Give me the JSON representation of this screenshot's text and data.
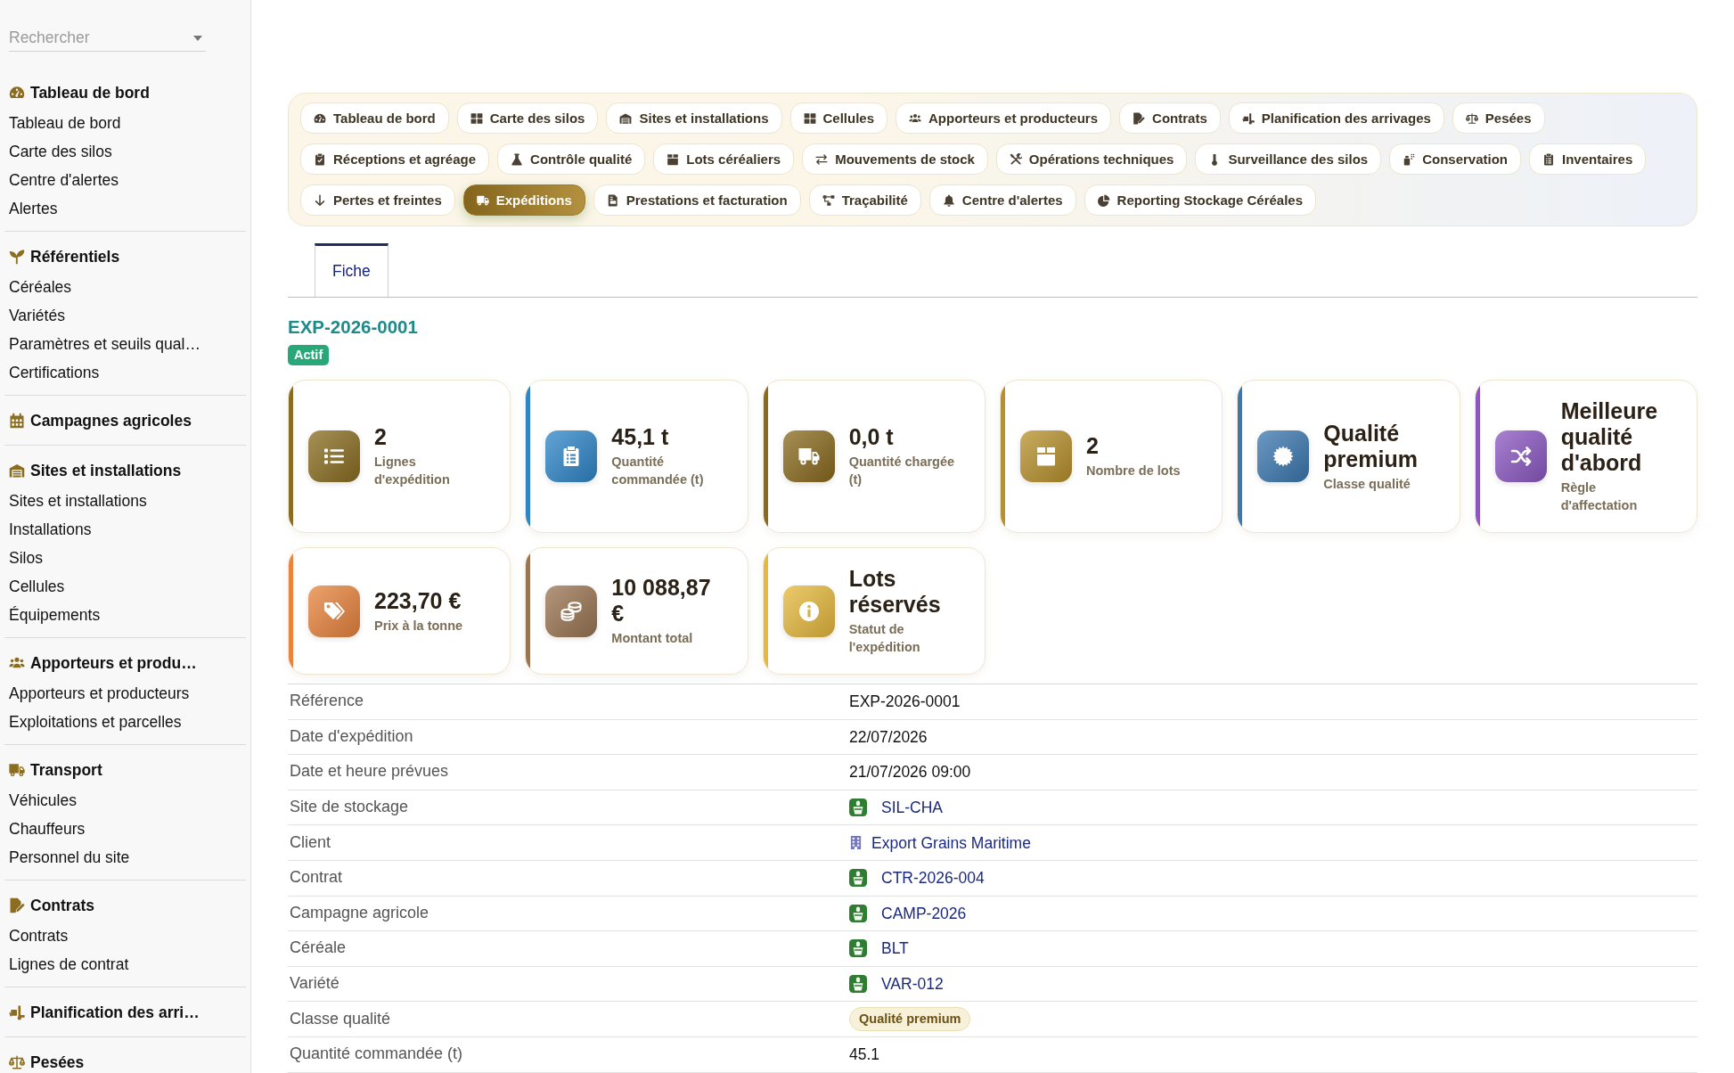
{
  "sidebar": {
    "search": {
      "placeholder": "Rechercher"
    },
    "sections": [
      {
        "title": "Tableau de bord",
        "items": [
          "Tableau de bord",
          "Carte des silos",
          "Centre d'alertes",
          "Alertes"
        ]
      },
      {
        "title": "Référentiels",
        "items": [
          "Céréales",
          "Variétés",
          "Paramètres et seuils qual…",
          "Certifications"
        ]
      },
      {
        "title": "Campagnes agricoles"
      },
      {
        "title": "Sites et installations",
        "items": [
          "Sites et installations",
          "Installations",
          "Silos",
          "Cellules",
          "Équipements"
        ]
      },
      {
        "title": "Apporteurs et produ…",
        "items": [
          "Apporteurs et producteurs",
          "Exploitations et parcelles"
        ]
      },
      {
        "title": "Transport",
        "items": [
          "Véhicules",
          "Chauffeurs",
          "Personnel du site"
        ]
      },
      {
        "title": "Contrats",
        "items": [
          "Contrats",
          "Lignes de contrat"
        ]
      },
      {
        "title": "Planification des arri…"
      },
      {
        "title": "Pesées"
      }
    ]
  },
  "nav": [
    {
      "label": "Tableau de bord",
      "selected": false
    },
    {
      "label": "Carte des silos",
      "selected": false
    },
    {
      "label": "Sites et installations",
      "selected": false
    },
    {
      "label": "Cellules",
      "selected": false
    },
    {
      "label": "Apporteurs et producteurs",
      "selected": false
    },
    {
      "label": "Contrats",
      "selected": false
    },
    {
      "label": "Planification des arrivages",
      "selected": false
    },
    {
      "label": "Pesées",
      "selected": false
    },
    {
      "label": "Réceptions et agréage",
      "selected": false
    },
    {
      "label": "Contrôle qualité",
      "selected": false
    },
    {
      "label": "Lots céréaliers",
      "selected": false
    },
    {
      "label": "Mouvements de stock",
      "selected": false
    },
    {
      "label": "Opérations techniques",
      "selected": false
    },
    {
      "label": "Surveillance des silos",
      "selected": false
    },
    {
      "label": "Conservation",
      "selected": false
    },
    {
      "label": "Inventaires",
      "selected": false
    },
    {
      "label": "Pertes et freintes",
      "selected": false
    },
    {
      "label": "Expéditions",
      "selected": true
    },
    {
      "label": "Prestations et facturation",
      "selected": false
    },
    {
      "label": "Traçabilité",
      "selected": false
    },
    {
      "label": "Centre d'alertes",
      "selected": false
    },
    {
      "label": "Reporting Stockage Céréales",
      "selected": false
    }
  ],
  "tabs": [
    {
      "label": "Fiche",
      "selected": true
    }
  ],
  "record": {
    "title": "EXP-2026-0001",
    "status": "Actif"
  },
  "cards": [
    {
      "value": "2",
      "label": "Lignes d'expédition",
      "color": "#8a6d1e"
    },
    {
      "value": "45,1 t",
      "label": "Quantité commandée (t)",
      "color": "#2e86c8"
    },
    {
      "value": "0,0 t",
      "label": "Quantité chargée (t)",
      "color": "#8a6a1c"
    },
    {
      "value": "2",
      "label": "Nombre de lots",
      "color": "#b8912b"
    },
    {
      "value": "Qualité premium",
      "label": "Classe qualité",
      "color": "#3b78b0"
    },
    {
      "value": "Meilleure qualité d'abord",
      "label": "Règle d'affectation",
      "color": "#8b58c2"
    },
    {
      "value": "223,70 €",
      "label": "Prix à la tonne",
      "color": "#e8843c"
    },
    {
      "value": "10 088,87 €",
      "label": "Montant total",
      "color": "#9a7552"
    },
    {
      "value": "Lots réservés",
      "label": "Statut de l'expédition",
      "color": "#e6b93c"
    }
  ],
  "details": [
    {
      "label": "Référence",
      "value": "EXP-2026-0001",
      "kind": "text"
    },
    {
      "label": "Date d'expédition",
      "value": "22/07/2026",
      "kind": "text"
    },
    {
      "label": "Date et heure prévues",
      "value": "21/07/2026 09:00",
      "kind": "text"
    },
    {
      "label": "Site de stockage",
      "value": "SIL-CHA",
      "kind": "record_link"
    },
    {
      "label": "Client",
      "value": "Export Grains Maritime",
      "kind": "company_link"
    },
    {
      "label": "Contrat",
      "value": "CTR-2026-004",
      "kind": "record_link"
    },
    {
      "label": "Campagne agricole",
      "value": "CAMP-2026",
      "kind": "record_link"
    },
    {
      "label": "Céréale",
      "value": "BLT",
      "kind": "record_link"
    },
    {
      "label": "Variété",
      "value": "VAR-012",
      "kind": "record_link"
    },
    {
      "label": "Classe qualité",
      "value": "Qualité premium",
      "kind": "badge"
    },
    {
      "label": "Quantité commandée (t)",
      "value": "45.1",
      "kind": "text"
    }
  ]
}
